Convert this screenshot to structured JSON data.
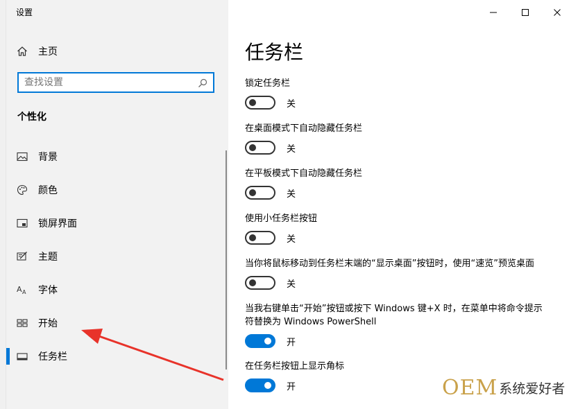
{
  "window": {
    "title": "设置"
  },
  "sidebar": {
    "home_label": "主页",
    "search_placeholder": "查找设置",
    "section_title": "个性化",
    "items": [
      {
        "label": "背景",
        "icon": "image-icon"
      },
      {
        "label": "颜色",
        "icon": "palette-icon"
      },
      {
        "label": "锁屏界面",
        "icon": "lock-screen-icon"
      },
      {
        "label": "主题",
        "icon": "theme-icon"
      },
      {
        "label": "字体",
        "icon": "font-icon"
      },
      {
        "label": "开始",
        "icon": "start-icon"
      },
      {
        "label": "任务栏",
        "icon": "taskbar-icon",
        "active": true
      }
    ]
  },
  "content": {
    "title": "任务栏",
    "settings": [
      {
        "label": "锁定任务栏",
        "on": false,
        "state": "关"
      },
      {
        "label": "在桌面模式下自动隐藏任务栏",
        "on": false,
        "state": "关"
      },
      {
        "label": "在平板模式下自动隐藏任务栏",
        "on": false,
        "state": "关"
      },
      {
        "label": "使用小任务栏按钮",
        "on": false,
        "state": "关"
      },
      {
        "label": "当你将鼠标移动到任务栏末端的“显示桌面”按钮时，使用“速览”预览桌面",
        "on": false,
        "state": "关"
      },
      {
        "label": "当我右键单击“开始”按钮或按下 Windows 键+X 时，在菜单中将命令提示符替换为 Windows PowerShell",
        "on": true,
        "state": "开"
      },
      {
        "label": "在任务栏按钮上显示角标",
        "on": true,
        "state": "开"
      }
    ]
  },
  "watermark": {
    "logo": "OEM",
    "text": "系统爱好者"
  },
  "colors": {
    "accent": "#0078d7",
    "arrow": "#e8332a",
    "sidebar_bg": "#f2f2f2"
  }
}
